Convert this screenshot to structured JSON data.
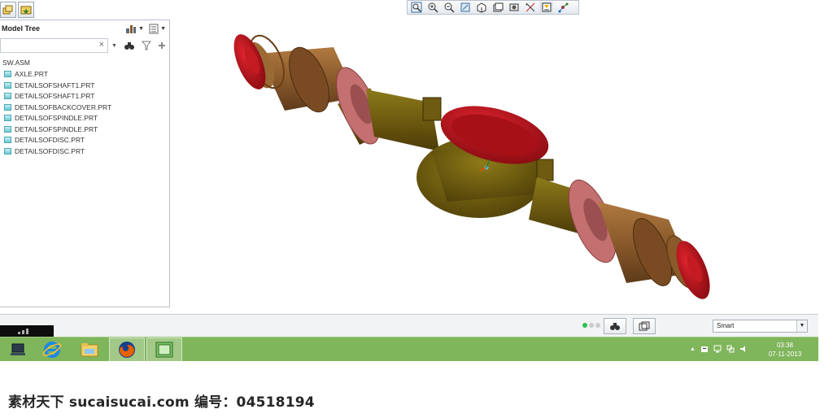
{
  "top_tabs": [
    {
      "icon": "layers-icon"
    },
    {
      "icon": "folder-star-icon"
    }
  ],
  "model_tree": {
    "title": "Model Tree",
    "search_clear": "×",
    "root": "SW.ASM",
    "items": [
      {
        "label": "AXLE.PRT"
      },
      {
        "label": "DETAILSOFSHAFT1.PRT"
      },
      {
        "label": "DETAILSOFSHAFT1.PRT"
      },
      {
        "label": "DETAILSOFBACKCOVER.PRT"
      },
      {
        "label": "DETAILSOFSPINDLE.PRT"
      },
      {
        "label": "DETAILSOFSPINDLE.PRT"
      },
      {
        "label": "DETAILSOFDISC.PRT"
      },
      {
        "label": "DETAILSOFDISC.PRT"
      }
    ]
  },
  "graphics_toolbar": {
    "icons": [
      "refit-icon",
      "zoom-in-icon",
      "zoom-out-icon",
      "repaint-icon",
      "display-style-icon",
      "saved-views-icon",
      "view-manager-icon",
      "datum-display-icon",
      "annotation-display-icon",
      "spin-center-icon"
    ]
  },
  "status_bar": {
    "filter_value": "Smart",
    "dropdown_arrow": "▼"
  },
  "taskbar": {
    "clock_time": "03:38",
    "clock_date": "07-11-2013",
    "tray_arrow": "▲"
  },
  "watermark": "素材天下 sucaisucai.com  编号：04518194",
  "colors": {
    "axle_body": "#6e5a10",
    "tube": "#8a5a2b",
    "flange": "#c47070",
    "end_cap": "#b0101a",
    "taskbar": "#7fb55b"
  }
}
